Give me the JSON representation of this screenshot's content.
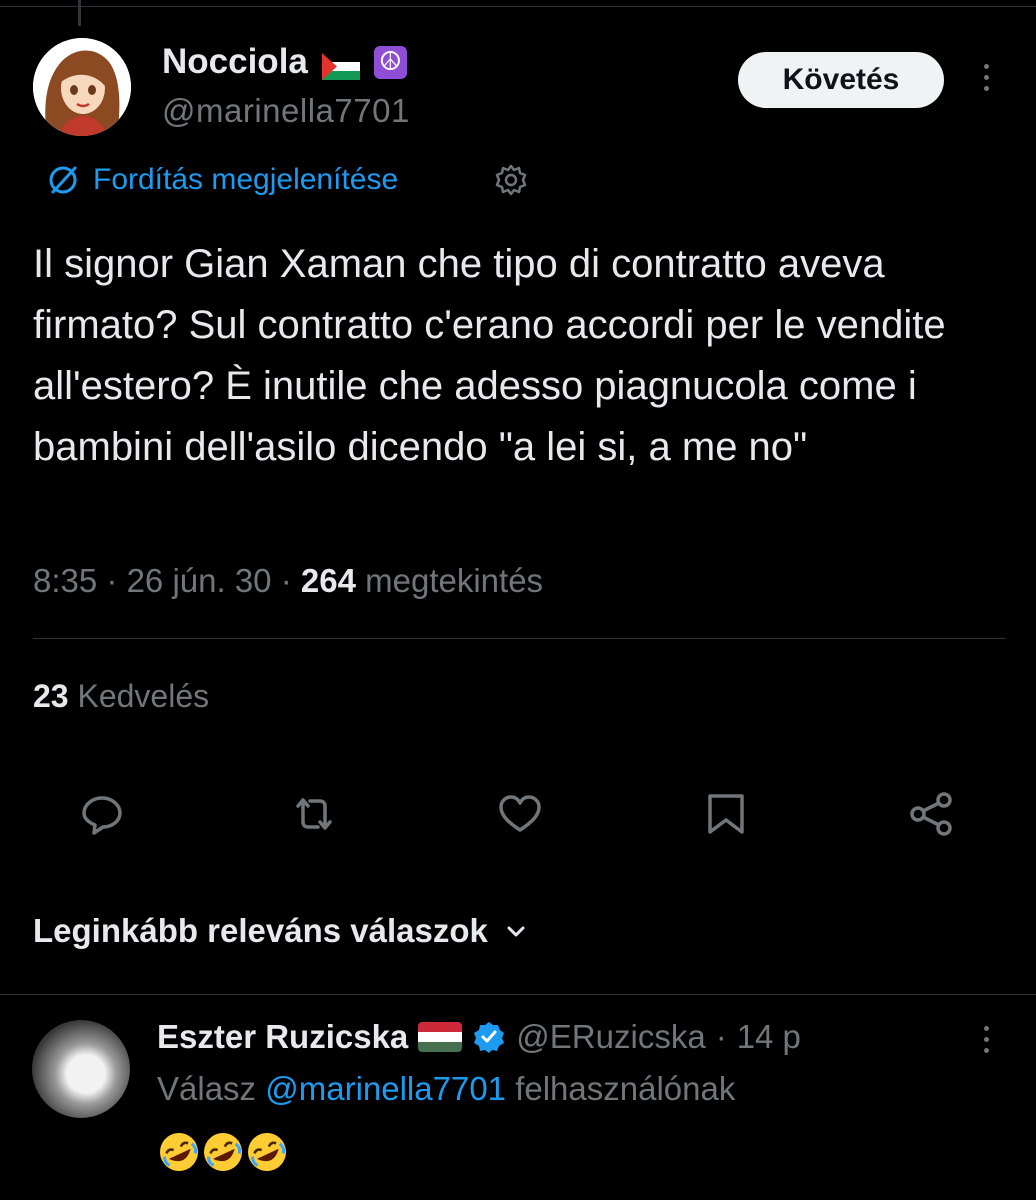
{
  "tweet": {
    "author": {
      "name": "Nocciola",
      "handle": "@marinella7701",
      "flag_emoji": "🇵🇸",
      "peace_emoji": "☮"
    },
    "follow_label": "Követés",
    "translate_label": "Fordítás megjelenítése",
    "text": "Il signor Gian Xaman  che tipo di contratto aveva firmato? Sul contratto c'erano accordi per le vendite all'estero? È inutile che adesso piagnucola come i bambini dell'asilo dicendo \"a lei si, a me no\"",
    "meta": {
      "time": "8:35",
      "sep1": "·",
      "date": "26 jún. 30",
      "sep2": "·",
      "views_count": "264",
      "views_label": "megtekintés"
    },
    "likes": {
      "count": "23",
      "label": "Kedvelés"
    },
    "actions": [
      "reply-icon",
      "retweet-icon",
      "like-icon",
      "bookmark-icon",
      "share-icon"
    ]
  },
  "replies_sort": {
    "label": "Leginkább releváns válaszok"
  },
  "reply": {
    "name": "Eszter Ruzicska",
    "flag_emoji": "🇭🇺",
    "handle": "@ERuzicska",
    "sep": "·",
    "time": "14 p",
    "reply_to_prefix": "Válasz",
    "reply_to_handle": "@marinella7701",
    "reply_to_suffix": "felhasználónak",
    "text": "🤣🤣🤣"
  },
  "colors": {
    "background": "#000000",
    "text": "#e7e9ea",
    "secondary": "#71767b",
    "accent": "#1d9bf0",
    "follow_bg": "#eff3f4"
  }
}
